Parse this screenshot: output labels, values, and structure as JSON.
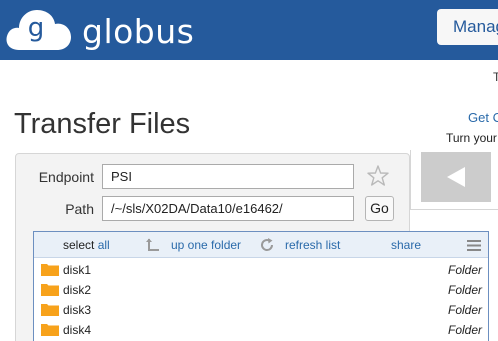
{
  "header": {
    "brand": "globus",
    "manage_label": "Manag",
    "top_fragment": "T"
  },
  "title": "Transfer Files",
  "side": {
    "get_fragment": "Get C",
    "turn_fragment": "Turn your"
  },
  "endpoint": {
    "label": "Endpoint",
    "value": "PSI"
  },
  "path": {
    "label": "Path",
    "value": "/~/sls/X02DA/Data10/e16462/"
  },
  "go_label": "Go",
  "toolbar": {
    "select_prefix": "select ",
    "select_all": "all",
    "up_one_folder": "up one folder",
    "refresh_list": "refresh list",
    "share": "share"
  },
  "files": [
    {
      "name": "disk1",
      "type": "Folder"
    },
    {
      "name": "disk2",
      "type": "Folder"
    },
    {
      "name": "disk3",
      "type": "Folder"
    },
    {
      "name": "disk4",
      "type": "Folder"
    }
  ],
  "colors": {
    "header_bg": "#255a9c",
    "link": "#2a6aaa",
    "folder": "#f7a21b"
  }
}
